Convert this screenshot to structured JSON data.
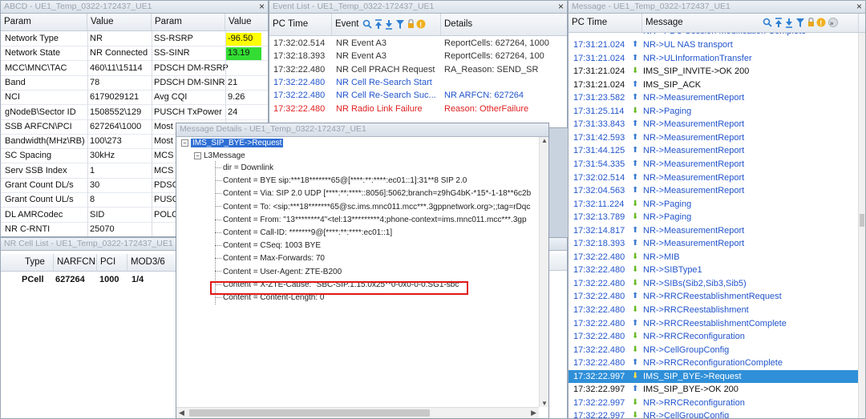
{
  "param_panel": {
    "title": "ABCD - UE1_Temp_0322-172437_UE1",
    "headers": [
      "Param",
      "Value",
      "Param",
      "Value"
    ],
    "rows": [
      [
        "Network Type",
        "NR",
        "SS-RSRP",
        "-96.50"
      ],
      [
        "Network State",
        "NR Connected",
        "SS-SINR",
        "13.19"
      ],
      [
        "MCC\\MNC\\TAC",
        "460\\11\\15114",
        "PDSCH DM-RSRP",
        ""
      ],
      [
        "Band",
        "78",
        "PDSCH DM-SINR",
        "21"
      ],
      [
        "NCI",
        "6179029121",
        "Avg CQI",
        "9.26"
      ],
      [
        "gNodeB\\Sector ID",
        "1508552\\129",
        "PUSCH TxPower",
        "24"
      ],
      [
        "SSB ARFCN\\PCI",
        "627264\\1000",
        "Most",
        ""
      ],
      [
        "Bandwidth(MHz\\RB)",
        "100\\273",
        "Most",
        ""
      ],
      [
        "SC Spacing",
        "30kHz",
        "MCS",
        ""
      ],
      [
        "Serv SSB Index",
        "1",
        "MCS",
        ""
      ],
      [
        "Grant Count DL/s",
        "30",
        "PDSC",
        ""
      ],
      [
        "Grant Count UL/s",
        "8",
        "PUSC",
        ""
      ],
      [
        "DL AMRCodec",
        "SID",
        "POLC",
        ""
      ],
      [
        "NR C-RNTI",
        "25070",
        "",
        ""
      ]
    ],
    "rsrp_color": "#ffff00",
    "sinr_color": "#33dd33"
  },
  "cell_list": {
    "title": "NR Cell List - UE1_Temp_0322-172437_UE1",
    "headers": [
      "Type",
      "NARFCN",
      "PCI",
      "MOD3/6"
    ],
    "rows": [
      [
        "PCell",
        "627264",
        "1000",
        "1/4"
      ]
    ]
  },
  "event_list": {
    "title": "Event List - UE1_Temp_0322-172437_UE1",
    "headers": [
      "PC Time",
      "Event",
      "Details"
    ],
    "rows": [
      {
        "time": "17:32:02.514",
        "event": "NR Event A3",
        "details": "ReportCells: 627264, 1000",
        "style": "gray"
      },
      {
        "time": "17:32:18.393",
        "event": "NR Event A3",
        "details": "ReportCells: 627264, 100",
        "style": "gray"
      },
      {
        "time": "17:32:22.480",
        "event": "NR Cell PRACH Request",
        "details": "RA_Reason: SEND_SR",
        "style": "gray"
      },
      {
        "time": "17:32:22.480",
        "event": "NR Cell Re-Search Start",
        "details": "",
        "style": "blue"
      },
      {
        "time": "17:32:22.480",
        "event": "NR Cell Re-Search Suc...",
        "details": "NR ARFCN: 627264",
        "style": "blue"
      },
      {
        "time": "17:32:22.480",
        "event": "NR Radio Link Failure",
        "details": "Reason: OtherFailure",
        "style": "red"
      }
    ]
  },
  "details": {
    "title": "Message Details - UE1_Temp_0322-172437_UE1",
    "root": "IMS_SIP_BYE->Request",
    "node": "L3Message",
    "lines": [
      "dir = Downlink",
      "Content = BYE sip:***18*******65@[****:**:****:ec01::1]:31**8 SIP 2.0",
      "Content = Via: SIP 2.0 UDP [****:**:****::8056]:5062;branch=z9hG4bK-*15*-1-18**6c2b",
      "Content = To: <sip:***18*******65@sc.ims.mnc011.mcc***.3gppnetwork.org>;;tag=rDqc",
      "Content = From: \"13********4\"<tel:13*********4;phone-context=ims.mnc011.mcc***.3gp",
      "Content = Call-ID: *******9@[****:**:****:ec01::1]",
      "Content = CSeq: 1003 BYE",
      "Content = Max-Forwards: 70",
      "Content = User-Agent: ZTE-B200",
      "Content = X-ZTE-Cause: \"SBC-SIP.1.15.0x25**0-0x0-0-0.SG1-sbc\"",
      "Content = Content-Length: 0"
    ],
    "highlight_index": 9
  },
  "message_list": {
    "title": "Message - UE1_Temp_0322-172437_UE1",
    "headers": [
      "PC Time",
      "Message"
    ],
    "top_partial": "NR->PDU Session Modification Complete",
    "rows": [
      {
        "time": "17:31:21.024",
        "dir": "up",
        "msg": "NR->UL NAS transport",
        "black": false
      },
      {
        "time": "17:31:21.024",
        "dir": "up",
        "msg": "NR->ULInformationTransfer",
        "black": false
      },
      {
        "time": "17:31:21.024",
        "dir": "dn",
        "msg": "IMS_SIP_INVITE->OK 200",
        "black": true
      },
      {
        "time": "17:31:21.024",
        "dir": "up",
        "msg": "IMS_SIP_ACK",
        "black": true
      },
      {
        "time": "17:31:23.582",
        "dir": "up",
        "msg": "NR->MeasurementReport",
        "black": false
      },
      {
        "time": "17:31:25.114",
        "dir": "dn",
        "msg": "NR->Paging",
        "black": false
      },
      {
        "time": "17:31:33.843",
        "dir": "up",
        "msg": "NR->MeasurementReport",
        "black": false
      },
      {
        "time": "17:31:42.593",
        "dir": "up",
        "msg": "NR->MeasurementReport",
        "black": false
      },
      {
        "time": "17:31:44.125",
        "dir": "up",
        "msg": "NR->MeasurementReport",
        "black": false
      },
      {
        "time": "17:31:54.335",
        "dir": "up",
        "msg": "NR->MeasurementReport",
        "black": false
      },
      {
        "time": "17:32:02.514",
        "dir": "up",
        "msg": "NR->MeasurementReport",
        "black": false
      },
      {
        "time": "17:32:04.563",
        "dir": "up",
        "msg": "NR->MeasurementReport",
        "black": false
      },
      {
        "time": "17:32:11.224",
        "dir": "dn",
        "msg": "NR->Paging",
        "black": false
      },
      {
        "time": "17:32:13.789",
        "dir": "dn",
        "msg": "NR->Paging",
        "black": false
      },
      {
        "time": "17:32:14.817",
        "dir": "up",
        "msg": "NR->MeasurementReport",
        "black": false
      },
      {
        "time": "17:32:18.393",
        "dir": "up",
        "msg": "NR->MeasurementReport",
        "black": false
      },
      {
        "time": "17:32:22.480",
        "dir": "dn",
        "msg": "NR->MIB",
        "black": false
      },
      {
        "time": "17:32:22.480",
        "dir": "dn",
        "msg": "NR->SIBType1",
        "black": false
      },
      {
        "time": "17:32:22.480",
        "dir": "dn",
        "msg": "NR->SIBs(Sib2,Sib3,Sib5)",
        "black": false
      },
      {
        "time": "17:32:22.480",
        "dir": "up",
        "msg": "NR->RRCReestablishmentRequest",
        "black": false
      },
      {
        "time": "17:32:22.480",
        "dir": "dn",
        "msg": "NR->RRCReestablishment",
        "black": false
      },
      {
        "time": "17:32:22.480",
        "dir": "up",
        "msg": "NR->RRCReestablishmentComplete",
        "black": false
      },
      {
        "time": "17:32:22.480",
        "dir": "dn",
        "msg": "NR->RRCReconfiguration",
        "black": false
      },
      {
        "time": "17:32:22.480",
        "dir": "dn",
        "msg": "NR->CellGroupConfig",
        "black": false
      },
      {
        "time": "17:32:22.480",
        "dir": "up",
        "msg": "NR->RRCReconfigurationComplete",
        "black": false
      },
      {
        "time": "17:32:22.997",
        "dir": "dn",
        "msg": "IMS_SIP_BYE->Request",
        "black": true,
        "selected": true
      },
      {
        "time": "17:32:22.997",
        "dir": "up",
        "msg": "IMS_SIP_BYE->OK 200",
        "black": true
      },
      {
        "time": "17:32:22.997",
        "dir": "dn",
        "msg": "NR->RRCReconfiguration",
        "black": false
      },
      {
        "time": "17:32:22.997",
        "dir": "dn",
        "msg": "NR->CellGroupConfig",
        "black": false
      }
    ]
  },
  "close_glyph": "×"
}
